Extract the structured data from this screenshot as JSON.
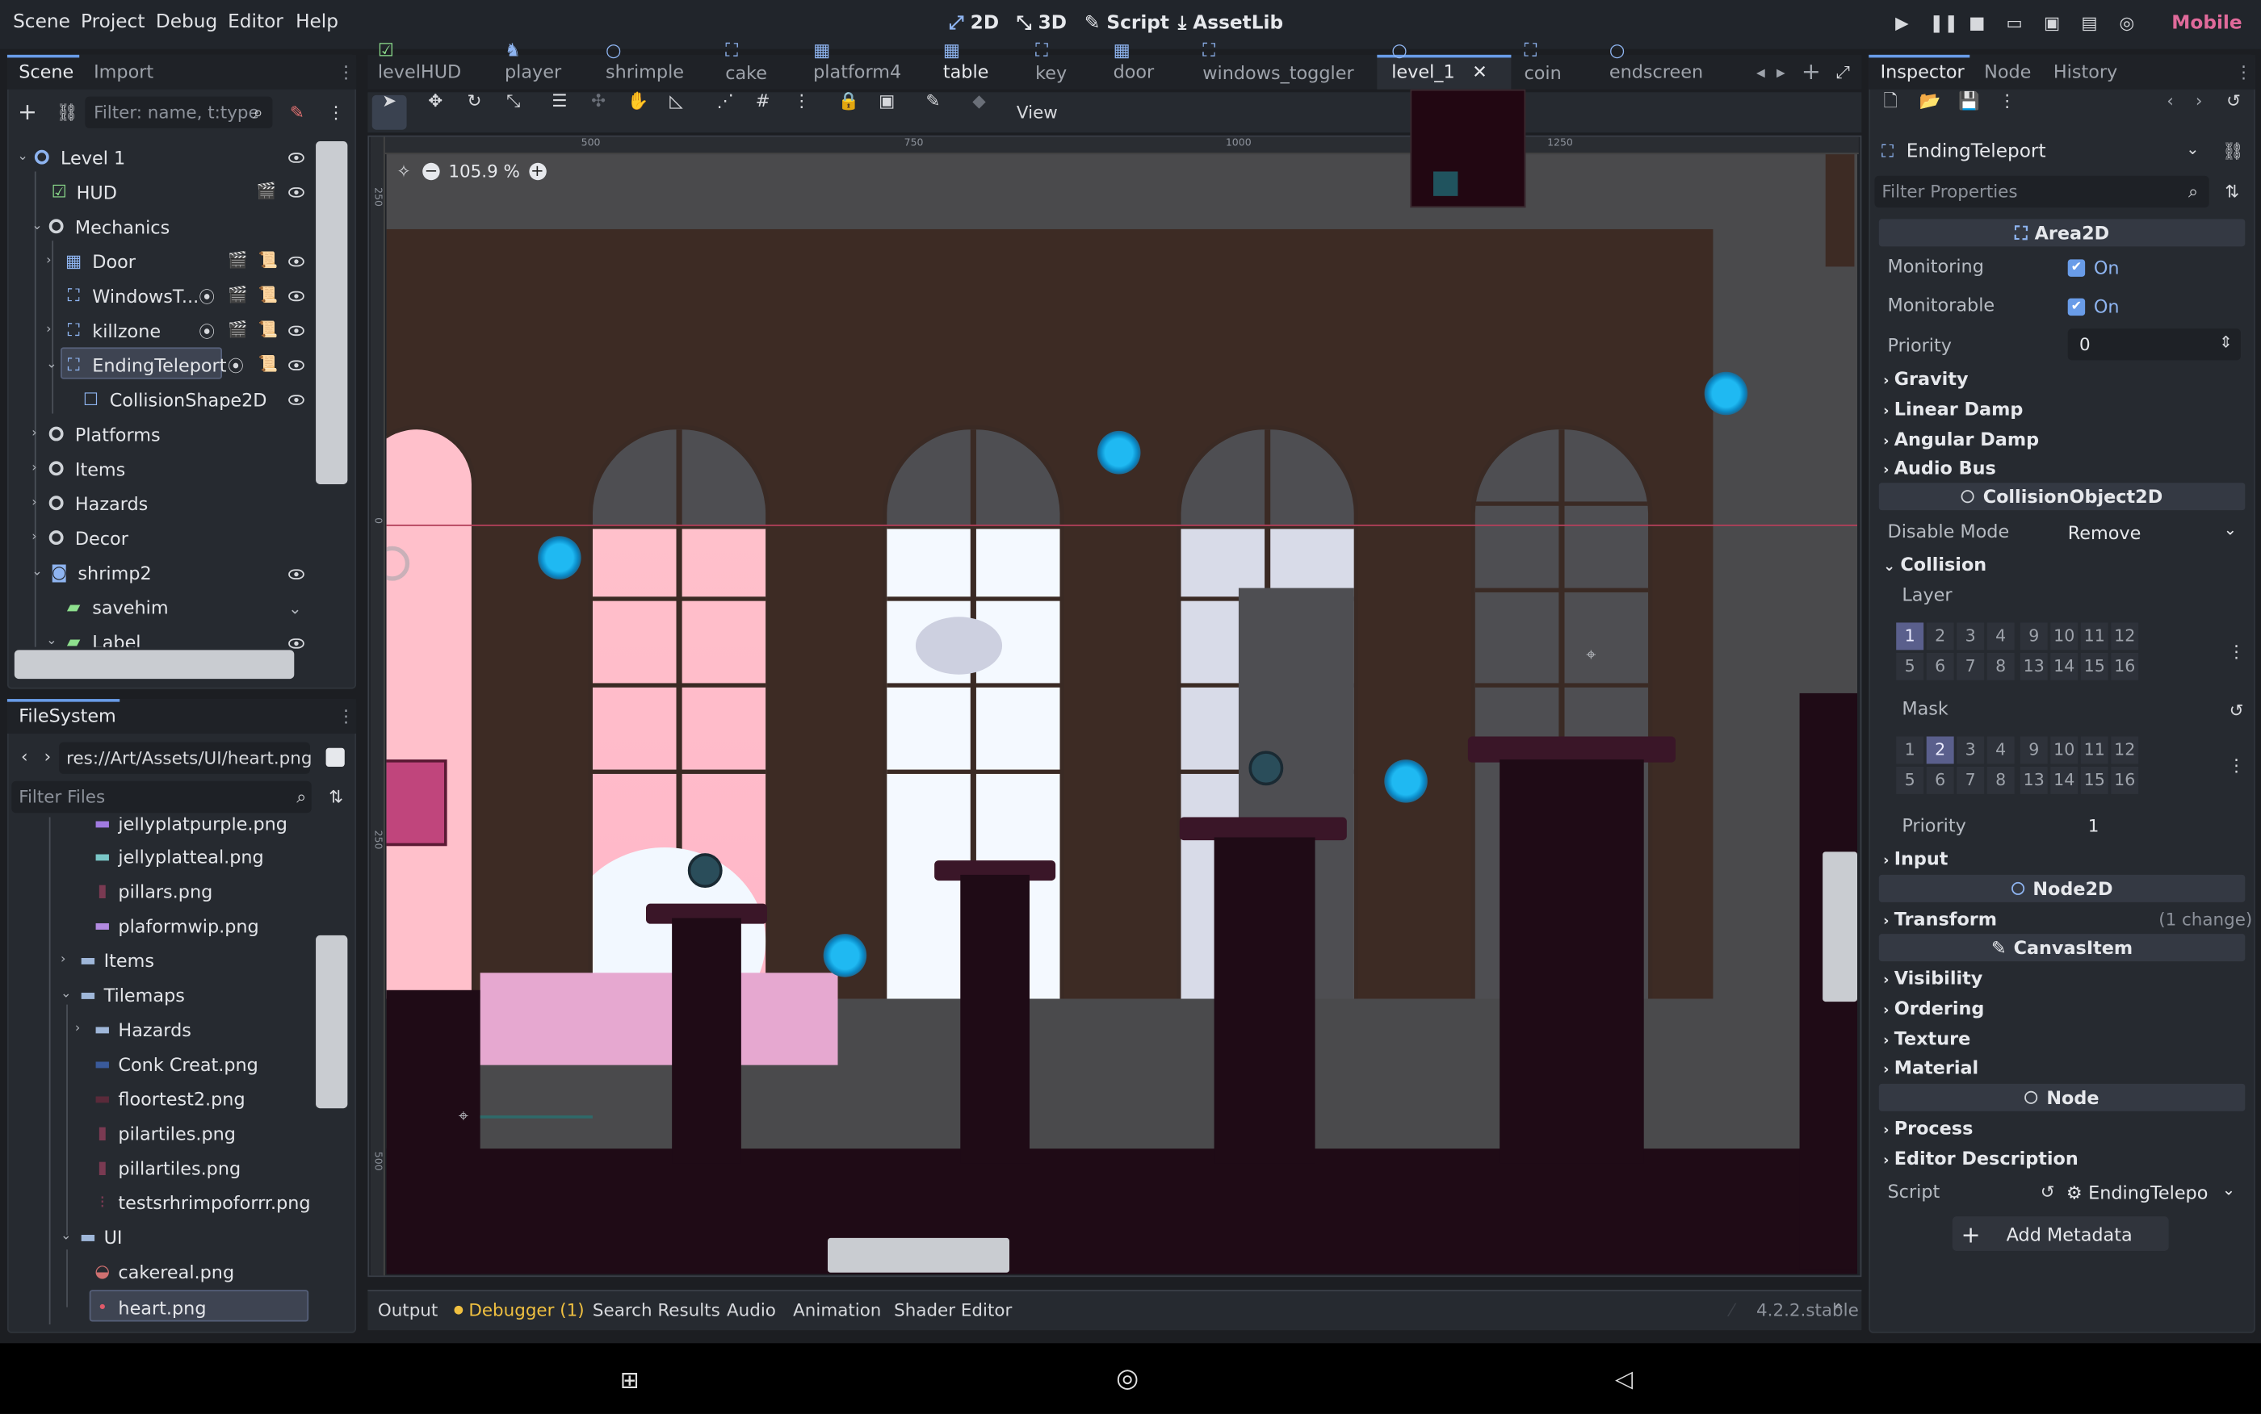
{
  "menu": [
    "Scene",
    "Project",
    "Debug",
    "Editor",
    "Help"
  ],
  "workspaces": [
    "2D",
    "3D",
    "Script",
    "AssetLib"
  ],
  "renderer": "Mobile",
  "colors": {
    "accent": "#699ce8",
    "coin": "#1fb9f2",
    "sky": "#ffc0cb",
    "wall": "#3d2b24",
    "floor": "#1f0b16",
    "renderer_text": "#e06a9a"
  },
  "scene_dock": {
    "tabs": [
      "Scene",
      "Import"
    ],
    "filter_placeholder": "Filter: name, t:type",
    "tree": [
      {
        "label": "Level 1",
        "icon": "node2d-icon"
      },
      {
        "label": "HUD",
        "icon": "control-icon"
      },
      {
        "label": "Mechanics",
        "icon": "node2d-icon"
      },
      {
        "label": "Door",
        "icon": "tilemap-icon"
      },
      {
        "label": "WindowsT...",
        "icon": "area2d-icon"
      },
      {
        "label": "killzone",
        "icon": "area2d-icon"
      },
      {
        "label": "EndingTeleport",
        "icon": "area2d-icon"
      },
      {
        "label": "CollisionShape2D",
        "icon": "collision-icon"
      },
      {
        "label": "Platforms",
        "icon": "node2d-icon"
      },
      {
        "label": "Items",
        "icon": "node2d-icon"
      },
      {
        "label": "Hazards",
        "icon": "node2d-icon"
      },
      {
        "label": "Decor",
        "icon": "node2d-icon"
      },
      {
        "label": "shrimp2",
        "icon": "characterbody-icon"
      },
      {
        "label": "savehim",
        "icon": "label-icon"
      },
      {
        "label": "Label",
        "icon": "label-icon"
      }
    ]
  },
  "filesystem": {
    "tab": "FileSystem",
    "path": "res://Art/Assets/UI/heart.png",
    "filter_placeholder": "Filter Files",
    "items": [
      {
        "label": "jellyplatpurple.png",
        "type": "file"
      },
      {
        "label": "jellyplatteal.png",
        "type": "file"
      },
      {
        "label": "pillars.png",
        "type": "file"
      },
      {
        "label": "plaformwip.png",
        "type": "file"
      },
      {
        "label": "Items",
        "type": "folder"
      },
      {
        "label": "Tilemaps",
        "type": "folder"
      },
      {
        "label": "Hazards",
        "type": "folder"
      },
      {
        "label": "Conk Creat.png",
        "type": "file"
      },
      {
        "label": "floortest2.png",
        "type": "file"
      },
      {
        "label": "pilartiles.png",
        "type": "file"
      },
      {
        "label": "pillartiles.png",
        "type": "file"
      },
      {
        "label": "testsrhrimpoforrr.png",
        "type": "file"
      },
      {
        "label": "UI",
        "type": "folder"
      },
      {
        "label": "cakereal.png",
        "type": "file"
      },
      {
        "label": "heart.png",
        "type": "file"
      }
    ]
  },
  "editor_tabs": [
    "levelHUD",
    "player",
    "shrimple",
    "cake",
    "platform4",
    "table",
    "key",
    "door",
    "windows_toggler",
    "level_1",
    "coin",
    "endscreen"
  ],
  "active_tab": "level_1",
  "toolbar": {
    "view_label": "View",
    "zoom": "105.9 %"
  },
  "ruler": [
    "500",
    "750",
    "1000",
    "1250"
  ],
  "ruler_v": [
    "250",
    "0",
    "250",
    "500"
  ],
  "bottom_tabs": [
    "Output",
    "Debugger (1)",
    "Search Results",
    "Audio",
    "Animation",
    "Shader Editor"
  ],
  "version": "4.2.2.stable",
  "inspector": {
    "tabs": [
      "Inspector",
      "Node",
      "History"
    ],
    "node_name": "EndingTeleport",
    "filter_placeholder": "Filter Properties",
    "sections": {
      "area2d": "Area2D",
      "collisionobject": "CollisionObject2D",
      "node2d": "Node2D",
      "canvasitem": "CanvasItem",
      "node": "Node"
    },
    "monitoring": {
      "label": "Monitoring",
      "value": "On"
    },
    "monitorable": {
      "label": "Monitorable",
      "value": "On"
    },
    "priority": {
      "label": "Priority",
      "value": "0"
    },
    "groups1": [
      "Gravity",
      "Linear Damp",
      "Angular Damp",
      "Audio Bus"
    ],
    "disable_mode": {
      "label": "Disable Mode",
      "value": "Remove"
    },
    "collision": "Collision",
    "layer_label": "Layer",
    "mask_label": "Mask",
    "bits_row1": [
      "1",
      "2",
      "3",
      "4",
      "9",
      "10",
      "11",
      "12"
    ],
    "bits_row2": [
      "5",
      "6",
      "7",
      "8",
      "13",
      "14",
      "15",
      "16"
    ],
    "priority2": {
      "label": "Priority",
      "value": "1"
    },
    "input": "Input",
    "transform": {
      "label": "Transform",
      "note": "(1 change)"
    },
    "canvas_groups": [
      "Visibility",
      "Ordering",
      "Texture",
      "Material"
    ],
    "node_groups": [
      "Process",
      "Editor Description"
    ],
    "script": {
      "label": "Script",
      "value": "EndingTelepo"
    },
    "add_metadata": "Add Metadata"
  }
}
